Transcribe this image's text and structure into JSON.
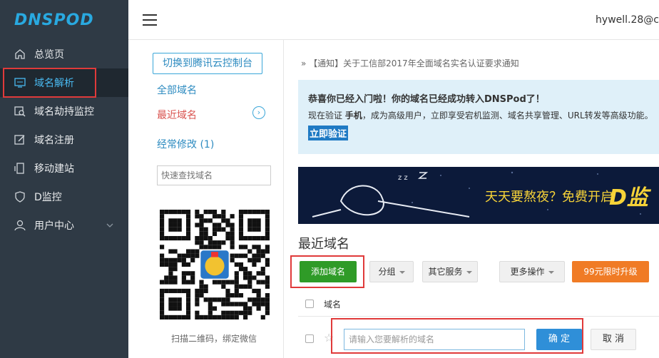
{
  "brand": {
    "logo_text": "DNSPOD",
    "accent": "#29a9e0",
    "sidebar_bg": "#2f3a45"
  },
  "header": {
    "user": "hywell.28@c"
  },
  "sidebar": {
    "items": [
      {
        "label": "总览页",
        "icon": "home-icon"
      },
      {
        "label": "域名解析",
        "icon": "dns-icon"
      },
      {
        "label": "域名劫持监控",
        "icon": "monitor-search-icon"
      },
      {
        "label": "域名注册",
        "icon": "edit-icon"
      },
      {
        "label": "移动建站",
        "icon": "mobile-site-icon"
      },
      {
        "label": "D监控",
        "icon": "shield-icon"
      },
      {
        "label": "用户中心",
        "icon": "user-icon"
      }
    ]
  },
  "midcol": {
    "switch_label": "切换到腾讯云控制台",
    "all_domains": "全部域名",
    "recent_domains": "最近域名",
    "frequent": "经常修改 (1)",
    "search_placeholder": "快速查找域名",
    "qr_caption": "扫描二维码，绑定微信"
  },
  "main": {
    "notice": "» 【通知】关于工信部2017年全面域名实名认证要求通知",
    "congrats_title": "恭喜你已经入门啦！你的域名已经成功转入DNSPod了！",
    "congrats_pre": "现在验证 ",
    "congrats_bold": "手机",
    "congrats_post": "，成为高级用户，立即享受宕机监测、域名共享管理、URL转发等高级功能。",
    "verify_label": "立即验证",
    "banner_text": "天天要熬夜？免费开启",
    "banner_d": "D监",
    "section_title": "最近域名",
    "buttons": {
      "add": "添加域名",
      "group": "分组",
      "other": "其它服务",
      "more": "更多操作",
      "upgrade": "99元限时升级"
    },
    "table_header": "域名",
    "domain_placeholder": "请输入您要解析的域名",
    "ok": "确 定",
    "cancel": "取 消"
  }
}
